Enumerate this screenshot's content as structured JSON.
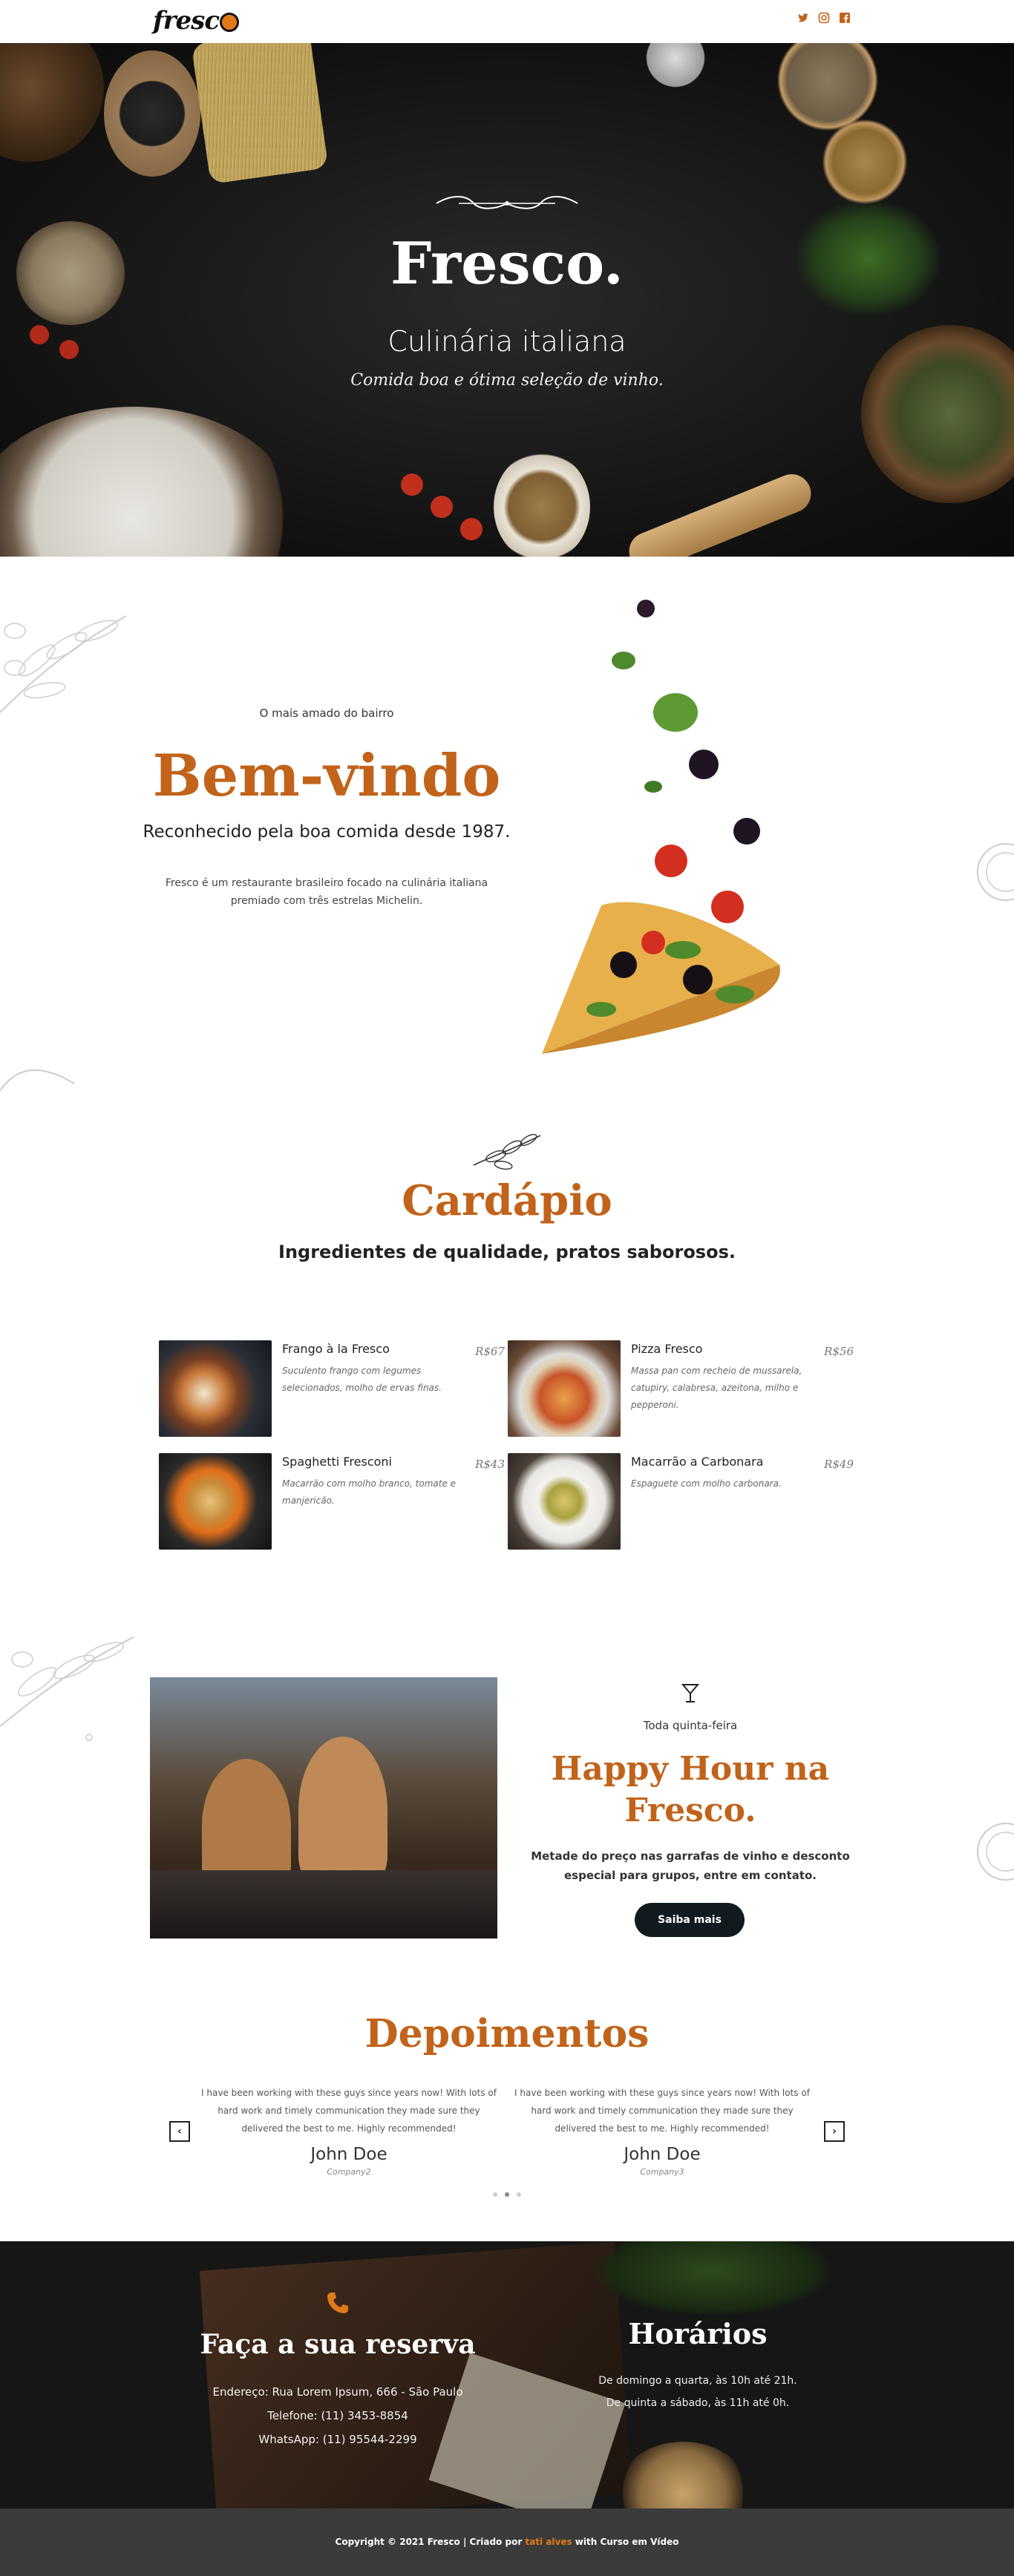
{
  "header": {
    "logo": "fresc",
    "social": [
      "twitter-icon",
      "instagram-icon",
      "facebook-icon"
    ]
  },
  "hero": {
    "title": "Fresco.",
    "subtitle": "Culinária italiana",
    "tagline": "Comida boa e ótima seleção de vinho."
  },
  "welcome": {
    "kicker": "O mais amado do bairro",
    "title": "Bem-vindo",
    "subtitle": "Reconhecido pela boa comida desde 1987.",
    "body": "Fresco é um restaurante brasileiro focado na culinária italiana premiado com três estrelas Michelin."
  },
  "menu": {
    "title": "Cardápio",
    "subtitle": "Ingredientes de qualidade, pratos saborosos.",
    "items": [
      {
        "name": "Frango à la Fresco",
        "price": "R$67",
        "desc": "Suculento frango com legumes selecionados, molho de ervas finas."
      },
      {
        "name": "Pizza Fresco",
        "price": "R$56",
        "desc": "Massa pan com recheio de mussarela, catupiry, calabresa, azeitona, milho e pepperoni."
      },
      {
        "name": "Spaghetti Fresconi",
        "price": "R$43",
        "desc": "Macarrão com molho branco, tomate e manjericão."
      },
      {
        "name": "Macarrão a Carbonara",
        "price": "R$49",
        "desc": "Espaguete com molho carbonara."
      }
    ]
  },
  "happy": {
    "kicker": "Toda quinta-feira",
    "title": "Happy Hour na Fresco.",
    "body": "Metade do preço nas garrafas de vinho e desconto especial para grupos, entre em contato.",
    "button": "Saiba mais"
  },
  "testimonials": {
    "title": "Depoimentos",
    "cards": [
      {
        "quote": "I have been working with these guys since years now! With lots of hard work and timely communication they made sure they delivered the best to me. Highly recommended!",
        "name": "John Doe",
        "company": "Company2"
      },
      {
        "quote": "I have been working with these guys since years now! With lots of hard work and timely communication they made sure they delivered the best to me. Highly recommended!",
        "name": "John Doe",
        "company": "Company3"
      }
    ],
    "prev": "‹",
    "next": "›"
  },
  "reserve": {
    "title": "Faça a sua reserva",
    "address": "Endereço: Rua Lorem Ipsum, 666 - São Paulo",
    "phone": "Telefone: (11) 3453-8854",
    "whatsapp": "WhatsApp: (11) 95544-2299"
  },
  "hours": {
    "title": "Horários",
    "line1": "De domingo a quarta, às 10h até 21h.",
    "line2": "De quinta a sábado, às 11h até 0h."
  },
  "footer": {
    "prefix": "Copyright © 2021 Fresco | Criado por",
    "author": "tati alves",
    "suffix": "with Curso em Vídeo"
  },
  "colors": {
    "accent": "#c1631a",
    "dark": "#111a1f",
    "footer": "#3b3b3b"
  }
}
